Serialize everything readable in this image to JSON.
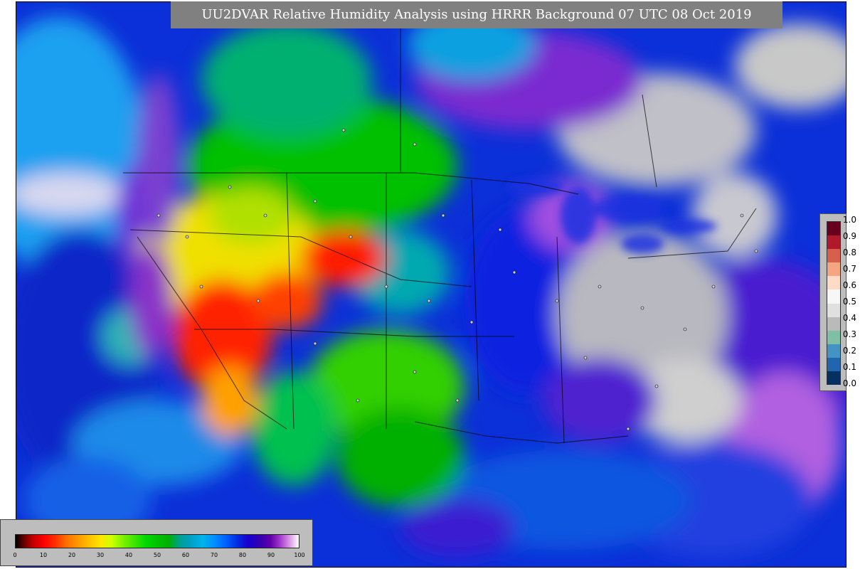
{
  "title": "UU2DVAR Relative Humidity Analysis using HRRR Background 07 UTC 08 Oct 2019",
  "colorbar": {
    "ticks": [
      "0",
      "10",
      "20",
      "30",
      "40",
      "50",
      "60",
      "70",
      "80",
      "90",
      "100"
    ]
  },
  "obs_legend": {
    "ticks": [
      "1.0",
      "0.9",
      "0.8",
      "0.7",
      "0.6",
      "0.5",
      "0.4",
      "0.3",
      "0.2",
      "0.1",
      "0.0"
    ],
    "colors": [
      "#67001f",
      "#b2182b",
      "#d6604d",
      "#f4a582",
      "#fddbc7",
      "#f7f7f7",
      "#e0e0e0",
      "#bababa",
      "#7fbfa6",
      "#4393c3",
      "#2166ac",
      "#053061"
    ]
  },
  "colors": {
    "ocean": "#0b2fd8",
    "dry": "#ff2000",
    "moist": "#00c000",
    "saturated": "#c8c8c8"
  }
}
